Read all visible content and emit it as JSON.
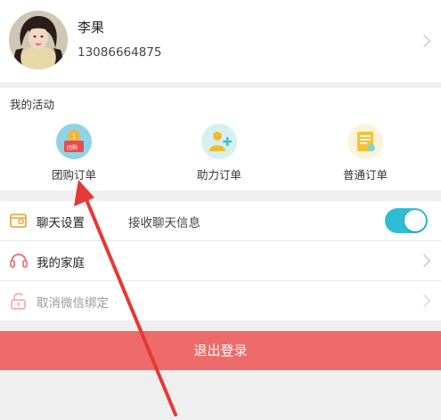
{
  "profile": {
    "name": "李果",
    "phone": "13086664875"
  },
  "activities": {
    "title": "我的活动",
    "items": [
      {
        "label": "团购订单",
        "icon": "group-buy-order-icon",
        "badge": "团购"
      },
      {
        "label": "助力订单",
        "icon": "assist-order-icon"
      },
      {
        "label": "普通订单",
        "icon": "normal-order-icon"
      }
    ]
  },
  "settings": {
    "chat": {
      "label": "聊天设置",
      "sub": "接收聊天信息",
      "toggle_on": true,
      "icon": "chat-settings-icon"
    },
    "family": {
      "label": "我的家庭",
      "icon": "family-icon"
    },
    "wechat_unbind": {
      "label": "取消微信绑定",
      "icon": "unlock-icon"
    }
  },
  "logout": {
    "label": "退出登录"
  },
  "colors": {
    "accent_teal": "#2fbcd6",
    "logout_red": "#ef6a6a",
    "annotation_red": "#e53935",
    "page_background": "#efefef"
  }
}
